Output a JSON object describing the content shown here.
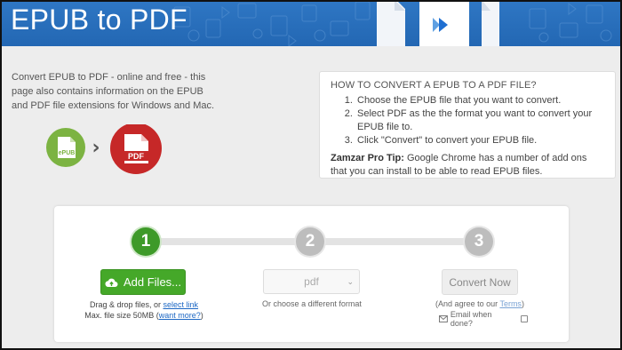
{
  "banner": {
    "title": "EPUB to PDF"
  },
  "intro": {
    "text": "Convert EPUB to PDF - online and free - this page also contains information on the EPUB and PDF file extensions for Windows and Mac."
  },
  "conversion_graphic": {
    "from_label": "ePUB",
    "to_label": "PDF",
    "arrow": "›"
  },
  "howto": {
    "heading": "HOW TO CONVERT A EPUB TO A PDF FILE?",
    "steps": [
      "Choose the EPUB file that you want to convert.",
      "Select PDF as the the format you want to convert your EPUB file to.",
      "Click \"Convert\" to convert your EPUB file."
    ],
    "tip_label": "Zamzar Pro Tip:",
    "tip_text": " Google Chrome has a number of add ons that you can install to be able to read EPUB files."
  },
  "converter": {
    "steps": [
      "1",
      "2",
      "3"
    ],
    "add_files_label": "Add Files...",
    "drag_text": "Drag & drop files, or ",
    "select_link": "select link",
    "max_size_text": "Max. file size 50MB (",
    "want_more_link": "want more?",
    "max_size_close": ")",
    "format_value": "pdf",
    "format_hint": "Or choose a different format",
    "convert_label": "Convert Now",
    "terms_prefix": "(And agree to our ",
    "terms_link": "Terms",
    "terms_suffix": ")",
    "email_label": "Email when done?"
  },
  "colors": {
    "banner": "#2a6fbd",
    "active_step": "#3e9a29",
    "inactive_step": "#bdbdbd",
    "add_button": "#45a829",
    "epub_circle": "#7cb342",
    "pdf_circle": "#c62828"
  },
  "icons": [
    "cloud-upload-icon",
    "chevron-down-icon",
    "envelope-icon",
    "play-icon",
    "document-icon"
  ]
}
